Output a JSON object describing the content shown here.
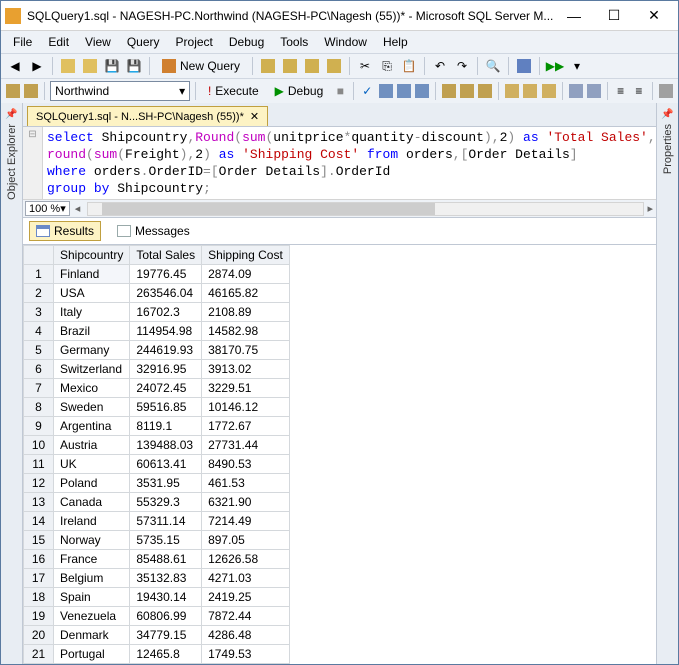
{
  "title": "SQLQuery1.sql - NAGESH-PC.Northwind (NAGESH-PC\\Nagesh (55))* - Microsoft SQL Server M...",
  "menu": [
    "File",
    "Edit",
    "View",
    "Query",
    "Project",
    "Debug",
    "Tools",
    "Window",
    "Help"
  ],
  "toolbar1": {
    "new_query": "New Query"
  },
  "toolbar2": {
    "db_combo": "Northwind",
    "execute": "Execute",
    "debug": "Debug"
  },
  "side_left": "Object Explorer",
  "side_right": "Properties",
  "doc_tab": "SQLQuery1.sql - N...SH-PC\\Nagesh (55))*",
  "sql": {
    "l1a": "select",
    "l1b": " Shipcountry",
    "l1c": ",",
    "l1d": "Round",
    "l1e": "(",
    "l1f": "sum",
    "l1g": "(",
    "l1h": "unitprice",
    "l1i": "*",
    "l1j": "quantity",
    "l1k": "-",
    "l1l": "discount",
    "l1m": "),",
    "l1n": "2",
    "l1o": ")",
    "l1p": " as ",
    "l1q": "'Total Sales'",
    "l1r": ",",
    "l2a": "round",
    "l2b": "(",
    "l2c": "sum",
    "l2d": "(",
    "l2e": "Freight",
    "l2f": "),",
    "l2g": "2",
    "l2h": ")",
    "l2i": " as ",
    "l2j": "'Shipping Cost'",
    "l2k": " from ",
    "l2l": "orders",
    "l2m": ",[",
    "l2n": "Order Details",
    "l2o": "]",
    "l3a": "where ",
    "l3b": "orders",
    "l3c": ".",
    "l3d": "OrderID",
    "l3e": "=[",
    "l3f": "Order Details",
    "l3g": "].",
    "l3h": "OrderId",
    "l4a": "group",
    "l4b": " by ",
    "l4c": "Shipcountry",
    "l4d": ";"
  },
  "zoom": "100 %",
  "result_tabs": {
    "results": "Results",
    "messages": "Messages"
  },
  "columns": [
    "Shipcountry",
    "Total Sales",
    "Shipping Cost"
  ],
  "rows": [
    {
      "n": "1",
      "c": [
        "Finland",
        "19776.45",
        "2874.09"
      ]
    },
    {
      "n": "2",
      "c": [
        "USA",
        "263546.04",
        "46165.82"
      ]
    },
    {
      "n": "3",
      "c": [
        "Italy",
        "16702.3",
        "2108.89"
      ]
    },
    {
      "n": "4",
      "c": [
        "Brazil",
        "114954.98",
        "14582.98"
      ]
    },
    {
      "n": "5",
      "c": [
        "Germany",
        "244619.93",
        "38170.75"
      ]
    },
    {
      "n": "6",
      "c": [
        "Switzerland",
        "32916.95",
        "3913.02"
      ]
    },
    {
      "n": "7",
      "c": [
        "Mexico",
        "24072.45",
        "3229.51"
      ]
    },
    {
      "n": "8",
      "c": [
        "Sweden",
        "59516.85",
        "10146.12"
      ]
    },
    {
      "n": "9",
      "c": [
        "Argentina",
        "8119.1",
        "1772.67"
      ]
    },
    {
      "n": "10",
      "c": [
        "Austria",
        "139488.03",
        "27731.44"
      ]
    },
    {
      "n": "11",
      "c": [
        "UK",
        "60613.41",
        "8490.53"
      ]
    },
    {
      "n": "12",
      "c": [
        "Poland",
        "3531.95",
        "461.53"
      ]
    },
    {
      "n": "13",
      "c": [
        "Canada",
        "55329.3",
        "6321.90"
      ]
    },
    {
      "n": "14",
      "c": [
        "Ireland",
        "57311.14",
        "7214.49"
      ]
    },
    {
      "n": "15",
      "c": [
        "Norway",
        "5735.15",
        "897.05"
      ]
    },
    {
      "n": "16",
      "c": [
        "France",
        "85488.61",
        "12626.58"
      ]
    },
    {
      "n": "17",
      "c": [
        "Belgium",
        "35132.83",
        "4271.03"
      ]
    },
    {
      "n": "18",
      "c": [
        "Spain",
        "19430.14",
        "2419.25"
      ]
    },
    {
      "n": "19",
      "c": [
        "Venezuela",
        "60806.99",
        "7872.44"
      ]
    },
    {
      "n": "20",
      "c": [
        "Denmark",
        "34779.15",
        "4286.48"
      ]
    },
    {
      "n": "21",
      "c": [
        "Portugal",
        "12465.8",
        "1749.53"
      ]
    }
  ]
}
